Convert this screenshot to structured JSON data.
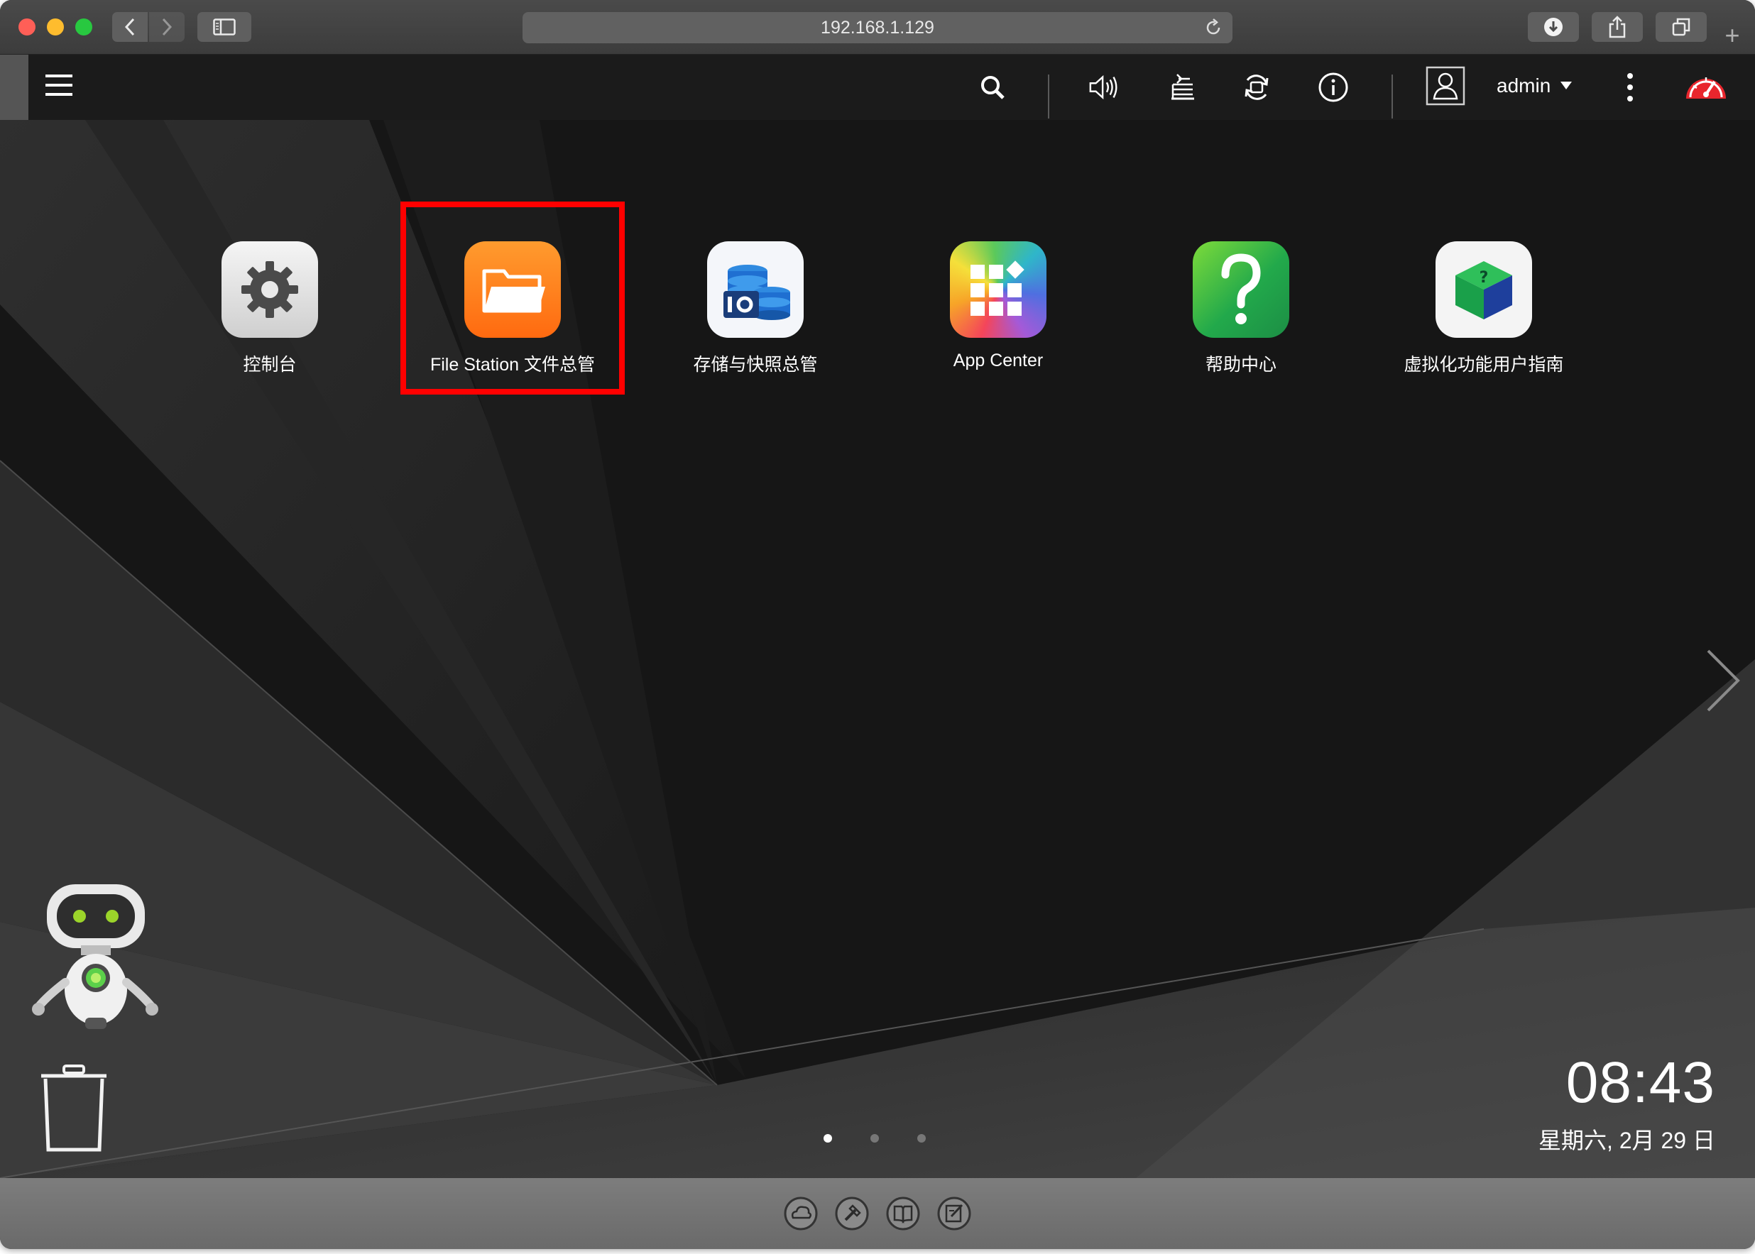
{
  "browser": {
    "url": "192.168.1.129",
    "new_tab_label": "+"
  },
  "topbar": {
    "user_label": "admin",
    "icons": [
      "menu-icon",
      "search-icon",
      "volume-icon",
      "tasks-icon",
      "sync-icon",
      "info-icon",
      "user-icon",
      "more-icon",
      "dashboard-icon"
    ]
  },
  "apps": [
    {
      "label": "控制台",
      "icon": "gear-icon"
    },
    {
      "label": "File Station 文件总管",
      "icon": "folder-icon"
    },
    {
      "label": "存储与快照总管",
      "icon": "storage-icon"
    },
    {
      "label": "App Center",
      "icon": "app-grid-icon"
    },
    {
      "label": "帮助中心",
      "icon": "help-icon"
    },
    {
      "label": "虚拟化功能用户指南",
      "icon": "virtualization-icon"
    }
  ],
  "desktop": {
    "active_page": 1,
    "page_count": 3,
    "selected_app": "File Station 文件总管"
  },
  "clock": {
    "time": "08:43",
    "date": "星期六, 2月 29 日"
  },
  "dock": {
    "icons": [
      "cloud-icon",
      "tools-icon",
      "book-icon",
      "notes-icon"
    ]
  },
  "colors": {
    "highlight": "#ff0000",
    "folder_orange": "#ff7a1a",
    "help_green": "#3fbf4a",
    "dashboard_red": "#e8262d"
  }
}
